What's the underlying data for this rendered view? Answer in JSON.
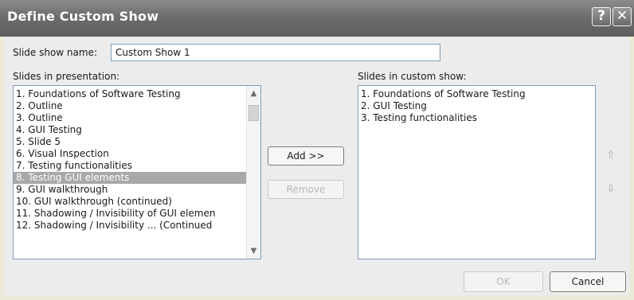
{
  "window": {
    "title": "Define Custom Show",
    "help_glyph": "?",
    "close_glyph": "✕"
  },
  "name_field": {
    "label": "Slide show name:",
    "value": "Custom Show 1"
  },
  "left_list": {
    "label": "Slides in presentation:",
    "items": [
      "1. Foundations of Software Testing",
      "2. Outline",
      "3. Outline",
      "4. GUI Testing",
      "5. Slide 5",
      "6. Visual Inspection",
      "7. Testing functionalities",
      "8. Testing GUI elements",
      "9. GUI walkthrough",
      "10. GUI walkthrough (continued)",
      "11. Shadowing / Invisibility of GUI elemen",
      "12. Shadowing / Invisibility ... (Continued"
    ],
    "selected_index": 7
  },
  "right_list": {
    "label": "Slides in custom show:",
    "items": [
      "1. Foundations of Software Testing",
      "2. GUI Testing",
      "3. Testing functionalities"
    ]
  },
  "buttons": {
    "add": "Add >>",
    "remove": "Remove",
    "ok": "OK",
    "cancel": "Cancel",
    "move_up_glyph": "⇧",
    "move_down_glyph": "⇩"
  },
  "scroll": {
    "up_glyph": "▲",
    "down_glyph": "▼"
  }
}
